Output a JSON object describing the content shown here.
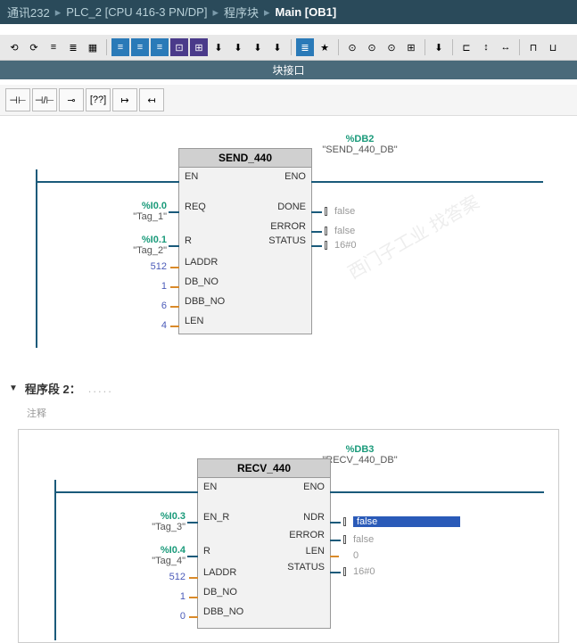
{
  "breadcrumb": {
    "items": [
      "通讯232",
      "PLC_2 [CPU 416-3 PN/DP]",
      "程序块"
    ],
    "current": "Main [OB1]"
  },
  "block_interface_label": "块接口",
  "section2": {
    "title": "程序段 2：",
    "comment": "注释"
  },
  "fb1": {
    "db_addr": "%DB2",
    "db_name": "\"SEND_440_DB\"",
    "title": "SEND_440",
    "inputs": {
      "en": "EN",
      "req": "REQ",
      "r": "R",
      "laddr": "LADDR",
      "db_no": "DB_NO",
      "dbb_no": "DBB_NO",
      "len": "LEN"
    },
    "outputs": {
      "eno": "ENO",
      "done": "DONE",
      "error": "ERROR",
      "status": "STATUS"
    },
    "in_vals": {
      "req_addr": "%I0.0",
      "req_name": "\"Tag_1\"",
      "r_addr": "%I0.1",
      "r_name": "\"Tag_2\"",
      "laddr": "512",
      "db_no": "1",
      "dbb_no": "6",
      "len": "4"
    },
    "out_vals": {
      "done": "false",
      "error": "false",
      "status": "16#0"
    }
  },
  "fb2": {
    "db_addr": "%DB3",
    "db_name": "\"RECV_440_DB\"",
    "title": "RECV_440",
    "inputs": {
      "en": "EN",
      "en_r": "EN_R",
      "r": "R",
      "laddr": "LADDR",
      "db_no": "DB_NO",
      "dbb_no": "DBB_NO"
    },
    "outputs": {
      "eno": "ENO",
      "ndr": "NDR",
      "error": "ERROR",
      "len": "LEN",
      "status": "STATUS"
    },
    "in_vals": {
      "enr_addr": "%I0.3",
      "enr_name": "\"Tag_3\"",
      "r_addr": "%I0.4",
      "r_name": "\"Tag_4\"",
      "laddr": "512",
      "db_no": "1",
      "dbb_no": "0"
    },
    "out_vals": {
      "ndr": "false",
      "error": "false",
      "len": "0",
      "status": "16#0"
    }
  }
}
